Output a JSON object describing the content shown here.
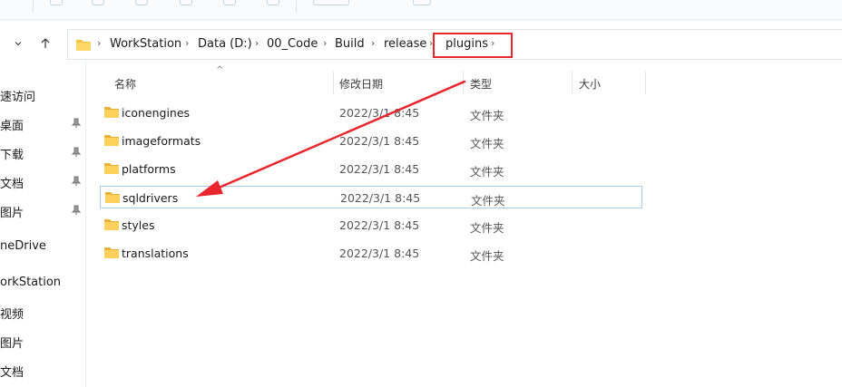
{
  "address_bar": {
    "crumbs": [
      "WorkStation",
      "Data (D:)",
      "00_Code",
      "Build",
      "release",
      "plugins"
    ]
  },
  "sidebar": {
    "items": [
      {
        "label": "速访问",
        "pinned": false
      },
      {
        "label": "桌面",
        "pinned": true
      },
      {
        "label": "下载",
        "pinned": true
      },
      {
        "label": "文档",
        "pinned": true
      },
      {
        "label": "图片",
        "pinned": true
      },
      {
        "label": "neDrive",
        "pinned": false
      },
      {
        "label": "orkStation",
        "pinned": false
      },
      {
        "label": "视频",
        "pinned": false
      },
      {
        "label": "图片",
        "pinned": false
      },
      {
        "label": "文档",
        "pinned": false
      }
    ]
  },
  "columns": {
    "name": "名称",
    "date": "修改日期",
    "type": "类型",
    "size": "大小"
  },
  "files": [
    {
      "name": "iconengines",
      "date": "2022/3/1 8:45",
      "type": "文件夹",
      "selected": false
    },
    {
      "name": "imageformats",
      "date": "2022/3/1 8:45",
      "type": "文件夹",
      "selected": false
    },
    {
      "name": "platforms",
      "date": "2022/3/1 8:45",
      "type": "文件夹",
      "selected": false
    },
    {
      "name": "sqldrivers",
      "date": "2022/3/1 8:45",
      "type": "文件夹",
      "selected": true
    },
    {
      "name": "styles",
      "date": "2022/3/1 8:45",
      "type": "文件夹",
      "selected": false
    },
    {
      "name": "translations",
      "date": "2022/3/1 8:45",
      "type": "文件夹",
      "selected": false
    }
  ],
  "colors": {
    "annotation": "#e8262d",
    "folder": "#f6c443",
    "selection_border": "#aecbe6"
  }
}
